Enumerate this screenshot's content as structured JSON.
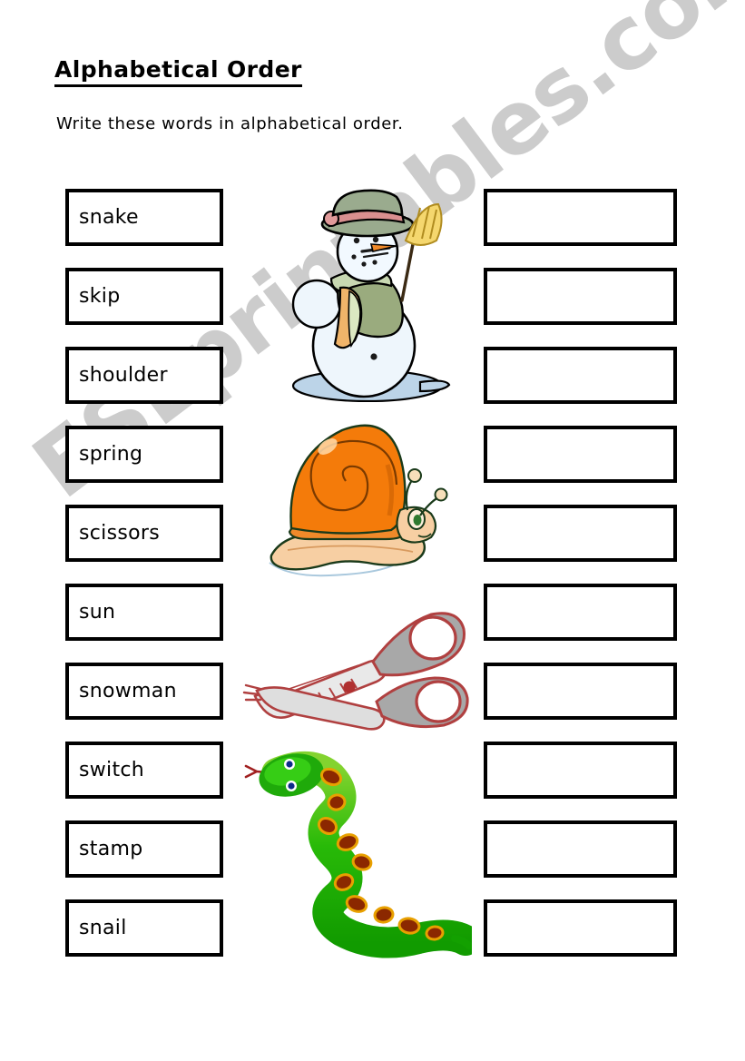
{
  "worksheet": {
    "title": "Alphabetical Order",
    "instruction": "Write these words in alphabetical order.",
    "watermark": "ESLprintables.com",
    "accent_colors": {
      "text": "#000000",
      "box_border": "#000000",
      "page_background": "#ffffff",
      "watermark": "#cccccc",
      "snail_shell": "#f47b0a",
      "snail_body": "#f5c99a",
      "snake_body": "#2fc60a",
      "snake_spots": "#8b2800",
      "scissors_blade": "#a8a8a8",
      "scissors_outline": "#b04040",
      "snowman_body": "#eaf4fb",
      "snowman_hat": "#9aab8e",
      "snowman_broom": "#f5d76e"
    }
  },
  "word_list": {
    "items": [
      {
        "word": "snake"
      },
      {
        "word": "skip"
      },
      {
        "word": "shoulder"
      },
      {
        "word": "spring"
      },
      {
        "word": "scissors"
      },
      {
        "word": "sun"
      },
      {
        "word": "snowman"
      },
      {
        "word": "switch"
      },
      {
        "word": "stamp"
      },
      {
        "word": "snail"
      }
    ]
  },
  "answer_boxes": {
    "count": 10,
    "items": [
      {
        "value": ""
      },
      {
        "value": ""
      },
      {
        "value": ""
      },
      {
        "value": ""
      },
      {
        "value": ""
      },
      {
        "value": ""
      },
      {
        "value": ""
      },
      {
        "value": ""
      },
      {
        "value": ""
      },
      {
        "value": ""
      }
    ]
  },
  "illustrations": [
    {
      "name": "snowman-illustration",
      "label": "snowman"
    },
    {
      "name": "snail-illustration",
      "label": "snail"
    },
    {
      "name": "scissors-illustration",
      "label": "scissors"
    },
    {
      "name": "snake-illustration",
      "label": "snake"
    }
  ]
}
